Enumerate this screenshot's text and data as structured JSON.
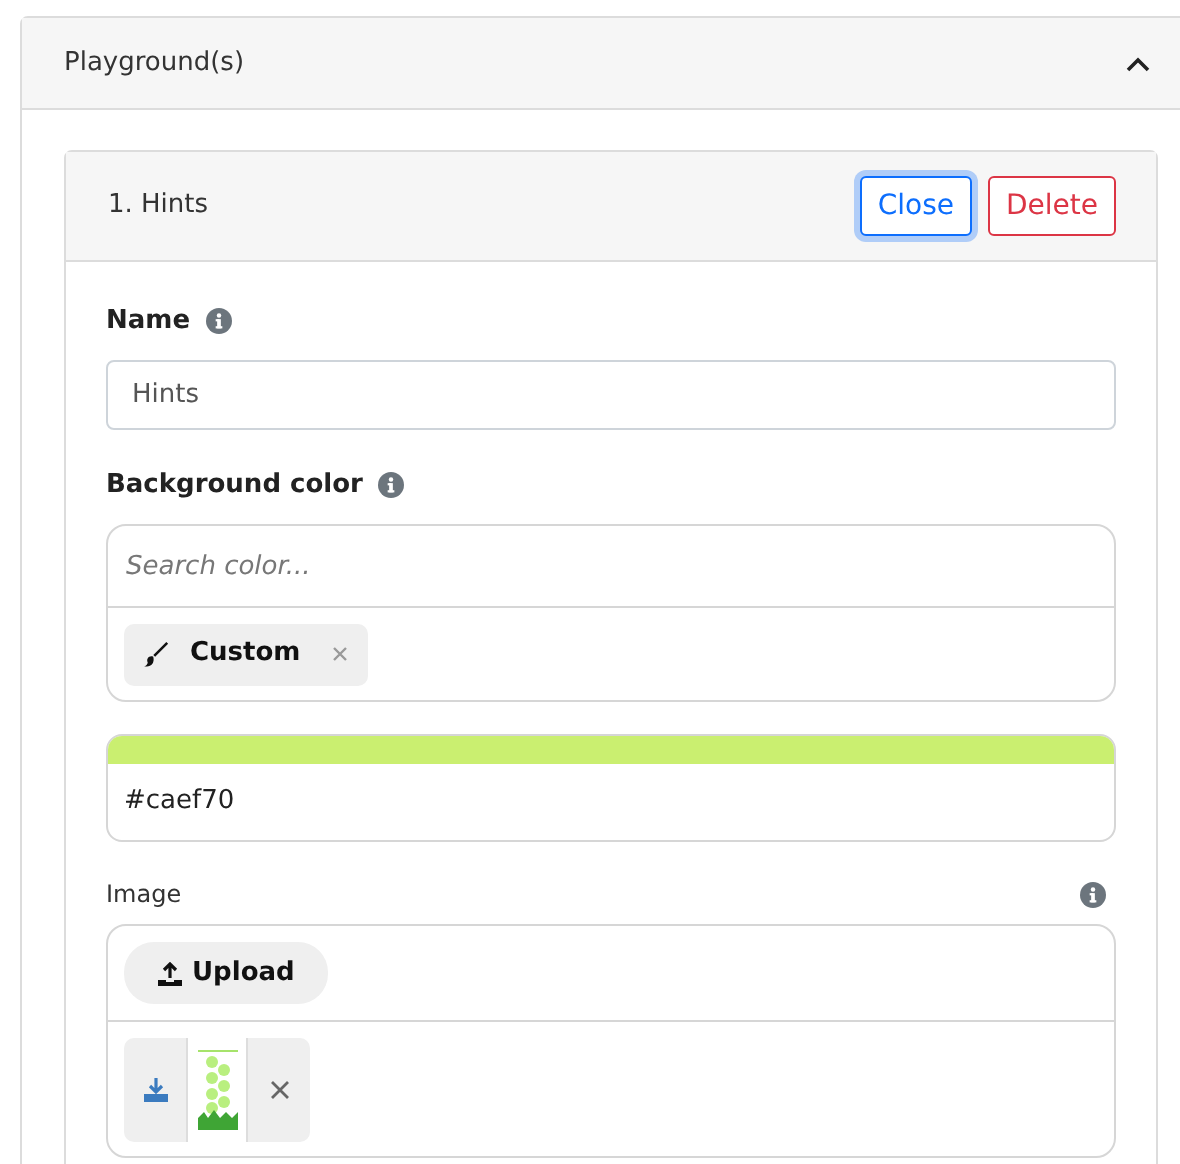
{
  "panel": {
    "title": "Playground(s)",
    "expanded": true
  },
  "item": {
    "title": "1. Hints",
    "buttons": [
      {
        "label": "Close",
        "kind": "primary",
        "focused": true
      },
      {
        "label": "Delete",
        "kind": "danger",
        "focused": false
      }
    ],
    "name_field": {
      "label": "Name",
      "value": "Hints"
    },
    "background": {
      "label": "Background color",
      "placeholder": "Search color...",
      "tag": "Custom",
      "value": "#caef70"
    },
    "image": {
      "label": "Image",
      "upload": "Upload"
    }
  }
}
